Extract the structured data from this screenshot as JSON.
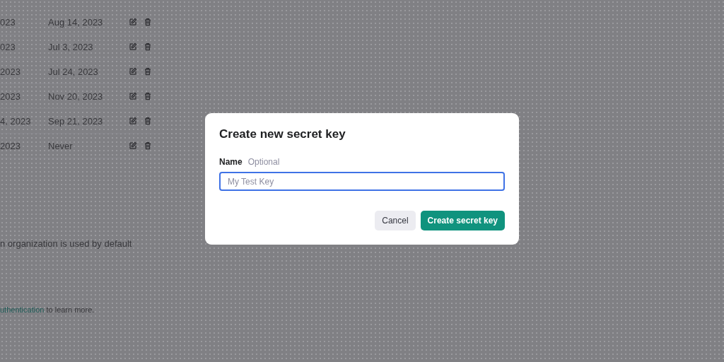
{
  "background_page": {
    "key_rows": [
      {
        "column_1": "023",
        "last_used": "Aug 14, 2023"
      },
      {
        "column_1": "023",
        "last_used": "Jul 3, 2023"
      },
      {
        "column_1": "2023",
        "last_used": "Jul 24, 2023"
      },
      {
        "column_1": "2023",
        "last_used": "Nov 20, 2023"
      },
      {
        "column_1": "4, 2023",
        "last_used": "Sep 21, 2023"
      },
      {
        "column_1": "2023",
        "last_used": "Never"
      }
    ],
    "organization_note": "n organization is used by default",
    "auth_note": {
      "link": "uthentication",
      "text": "to learn more."
    }
  },
  "dialog": {
    "title": "Create new secret key",
    "field_label": "Name",
    "field_hint": "Optional",
    "placeholder": "My Test Key",
    "focused": true,
    "buttons": [
      {
        "label": "Cancel",
        "kind": "secondary"
      },
      {
        "label": "Create secret key",
        "kind": "primary"
      }
    ]
  }
}
